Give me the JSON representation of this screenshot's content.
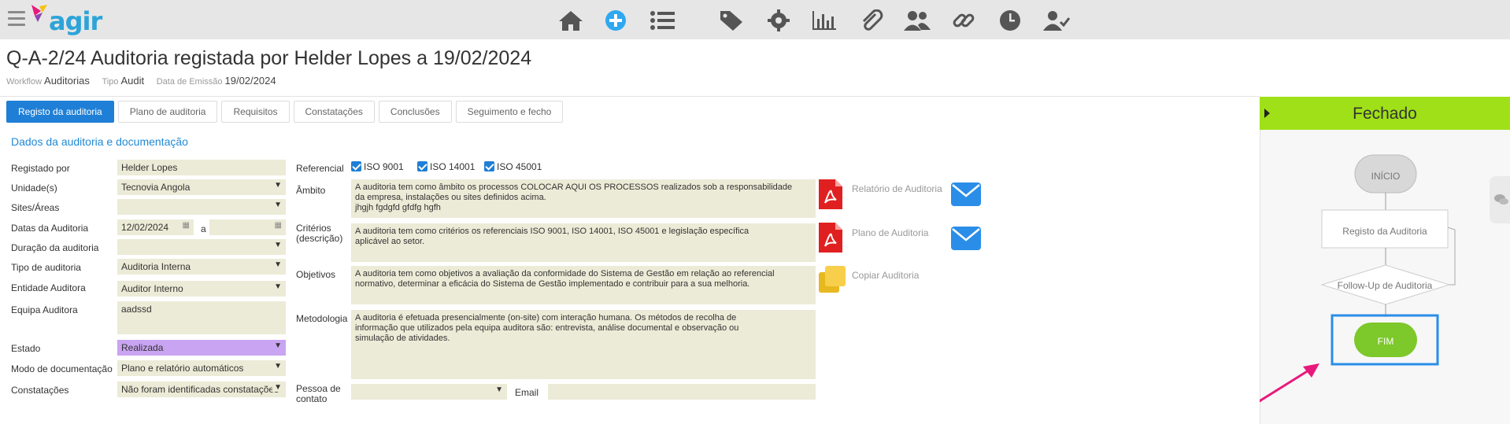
{
  "app": {
    "logo_text": "agir"
  },
  "nav_icons": [
    "home-icon",
    "add-icon",
    "list-icon",
    "tag-icon",
    "gear-icon",
    "chart-icon",
    "paperclip-icon",
    "users-icon",
    "link-icon",
    "clock-icon",
    "user-check-icon"
  ],
  "header": {
    "title": "Q-A-2/24 Auditoria registada por Helder Lopes a 19/02/2024",
    "workflow_label": "Workflow",
    "workflow_value": "Auditorias",
    "type_label": "Tipo",
    "type_value": "Audit",
    "date_label": "Data de Emissão",
    "date_value": "19/02/2024"
  },
  "tabs": [
    {
      "label": "Registo da auditoria",
      "active": true
    },
    {
      "label": "Plano de auditoria"
    },
    {
      "label": "Requisitos"
    },
    {
      "label": "Constatações"
    },
    {
      "label": "Conclusões"
    },
    {
      "label": "Seguimento e fecho"
    }
  ],
  "section_title": "Dados da auditoria e documentação",
  "form": {
    "registado_por": {
      "label": "Registado por",
      "value": "Helder Lopes"
    },
    "unidades": {
      "label": "Unidade(s)",
      "value": "Tecnovia Angola"
    },
    "sites": {
      "label": "Sites/Áreas",
      "value": ""
    },
    "datas": {
      "label": "Datas da Auditoria",
      "from": "12/02/2024",
      "sep": "a",
      "to": ""
    },
    "duracao": {
      "label": "Duração da auditoria",
      "value": ""
    },
    "tipo": {
      "label": "Tipo de auditoria",
      "value": "Auditoria Interna"
    },
    "entidade": {
      "label": "Entidade Auditora",
      "value": "Auditor Interno"
    },
    "equipa": {
      "label": "Equipa Auditora",
      "value": "aadssd"
    },
    "estado": {
      "label": "Estado",
      "value": "Realizada"
    },
    "modo": {
      "label": "Modo de documentação",
      "value": "Plano e relatório automáticos"
    },
    "constatacoes": {
      "label": "Constatações",
      "value": "Não foram identificadas constatações"
    }
  },
  "right_form": {
    "referencial_label": "Referencial",
    "referenciais": [
      "ISO 9001",
      "ISO 14001",
      "ISO 45001"
    ],
    "ambito_label": "Âmbito",
    "ambito_l1": "A auditoria tem como âmbito os processos COLOCAR AQUI OS PROCESSOS realizados sob a responsabilidade",
    "ambito_l2": "da empresa, instalações ou sites definidos acima.",
    "ambito_l3": "jhgjh fgdgfd gfdfg hgfh",
    "criterios_label_1": "Critérios",
    "criterios_label_2": "(descrição)",
    "criterios_l1": "A auditoria tem como critérios os referenciais ISO 9001, ISO 14001, ISO 45001 e legislação específica",
    "criterios_l2": "aplicável ao setor.",
    "objetivos_label": "Objetivos",
    "objetivos_l1": "A auditoria tem como objetivos a avaliação da conformidade do Sistema de Gestão em relação ao referencial",
    "objetivos_l2": "normativo, determinar a eficácia do Sistema de Gestão implementado e contribuir para a sua melhoria.",
    "metodologia_label": "Metodologia",
    "metodologia_l1": "A auditoria é efetuada presencialmente (on-site) com interação humana. Os métodos de recolha de",
    "metodologia_l2": "informação que  utilizados pela equipa auditora são: entrevista, análise documental e observação ou",
    "metodologia_l3": "simulação de atividades.",
    "pessoa_label_1": "Pessoa de",
    "pessoa_label_2": "contato",
    "pessoa_value": "",
    "email_label": "Email",
    "email_value": ""
  },
  "documents": {
    "relatorio": "Relatório de Auditoria",
    "plano": "Plano de Auditoria",
    "copiar": "Copiar Auditoria"
  },
  "workflow_panel": {
    "status": "Fechado",
    "start": "INÍCIO",
    "step1": "Registo da Auditoria",
    "step2": "Follow-Up de Auditoria",
    "end": "FIM"
  },
  "colors": {
    "accent": "#1f7fd6",
    "status_green": "#9fe018",
    "fim_green": "#7dc82a",
    "estado_purple": "#c9a4f2",
    "arrow_pink": "#e8197c"
  }
}
